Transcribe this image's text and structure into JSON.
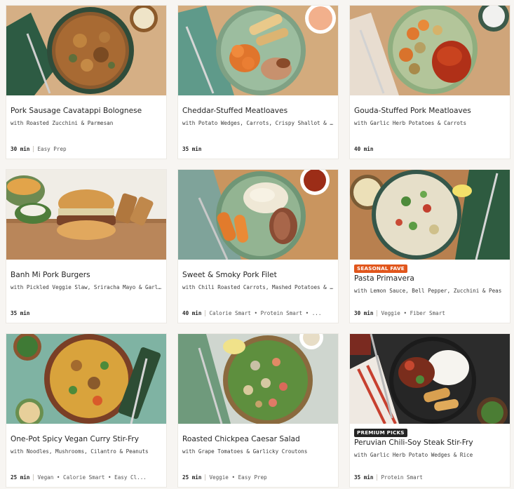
{
  "colors": {
    "seasonal_badge": "#e1561c",
    "premium_badge": "#242424",
    "card_background": "#ffffff",
    "page_background": "#f7f5f2"
  },
  "recipes": [
    {
      "title": "Pork Sausage Cavatappi Bolognese",
      "subtitle": "with Roasted Zucchini & Parmesan",
      "time": "30 min",
      "tags": "Easy Prep",
      "badge": ""
    },
    {
      "title": "Cheddar-Stuffed Meatloaves",
      "subtitle": "with Potato Wedges, Carrots, Crispy Shallot & Speci...",
      "time": "35 min",
      "tags": "",
      "badge": ""
    },
    {
      "title": "Gouda-Stuffed Pork Meatloaves",
      "subtitle": "with Garlic Herb Potatoes & Carrots",
      "time": "40 min",
      "tags": "",
      "badge": ""
    },
    {
      "title": "Banh Mi Pork Burgers",
      "subtitle": "with Pickled Veggie Slaw, Sriracha Mayo & Garlic Po...",
      "time": "35 min",
      "tags": "",
      "badge": ""
    },
    {
      "title": "Sweet & Smoky Pork Filet",
      "subtitle": "with Chili Roasted Carrots, Mashed Potatoes & Cher...",
      "time": "40 min",
      "tags": "Calorie Smart • Protein Smart • ...",
      "badge": ""
    },
    {
      "title": "Pasta Primavera",
      "subtitle": "with Lemon Sauce, Bell Pepper, Zucchini & Peas",
      "time": "30 min",
      "tags": "Veggie • Fiber Smart",
      "badge": "SEASONAL FAVE"
    },
    {
      "title": "One-Pot Spicy Vegan Curry Stir-Fry",
      "subtitle": "with Noodles, Mushrooms, Cilantro & Peanuts",
      "time": "25 min",
      "tags": "Vegan • Calorie Smart • Easy Cl...",
      "badge": ""
    },
    {
      "title": "Roasted Chickpea Caesar Salad",
      "subtitle": "with Grape Tomatoes & Garlicky Croutons",
      "time": "25 min",
      "tags": "Veggie • Easy Prep",
      "badge": ""
    },
    {
      "title": "Peruvian Chili-Soy Steak Stir-Fry",
      "subtitle": "with Garlic Herb Potato Wedges & Rice",
      "time": "35 min",
      "tags": "Protein Smart",
      "badge": "PREMIUM PICKS"
    }
  ]
}
